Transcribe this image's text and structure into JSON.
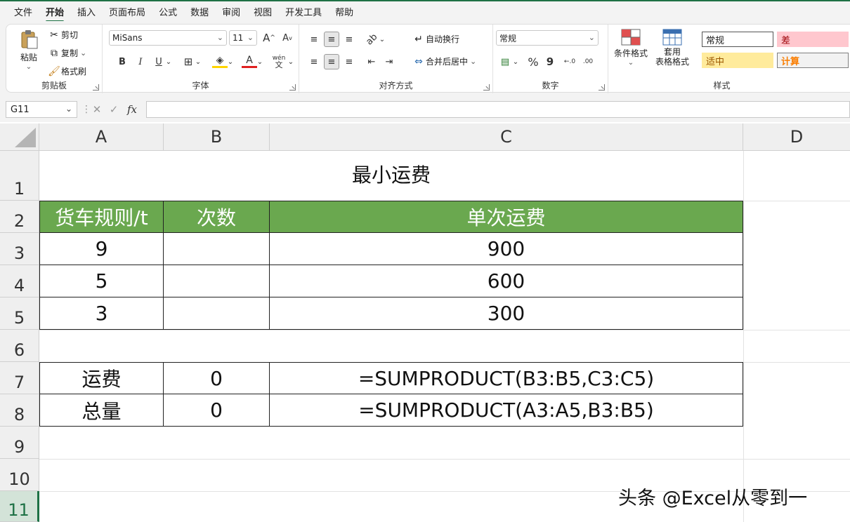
{
  "menu": {
    "items": [
      "文件",
      "开始",
      "插入",
      "页面布局",
      "公式",
      "数据",
      "审阅",
      "视图",
      "开发工具",
      "帮助"
    ],
    "active": "开始"
  },
  "ribbon": {
    "clipboard": {
      "paste": "粘贴",
      "cut": "剪切",
      "copy": "复制",
      "format_painter": "格式刷",
      "label": "剪贴板"
    },
    "font": {
      "name": "MiSans",
      "size": "11",
      "grow": "A",
      "shrink": "A",
      "bold": "B",
      "italic": "I",
      "underline": "U",
      "font_color": "A",
      "wen": "wén",
      "label": "字体"
    },
    "align": {
      "wrap": "自动换行",
      "merge": "合并后居中",
      "label": "对齐方式"
    },
    "number": {
      "format": "常规",
      "percent": "%",
      "comma": "9",
      "label": "数字"
    },
    "styles": {
      "conditional": "条件格式",
      "table_line1": "套用",
      "table_line2": "表格格式",
      "cells": [
        {
          "text": "常规",
          "bg": "#ffffff",
          "fg": "#222222",
          "border": "#555555"
        },
        {
          "text": "差",
          "bg": "#ffc7ce",
          "fg": "#9c0006",
          "border": "#ffc7ce"
        },
        {
          "text": "适中",
          "bg": "#ffeb9c",
          "fg": "#9c5700",
          "border": "#ffeb9c"
        },
        {
          "text": "计算",
          "bg": "#f2f2f2",
          "fg": "#fa7d00",
          "border": "#7f7f7f"
        }
      ],
      "label": "样式"
    }
  },
  "formula_bar": {
    "name_box": "G11",
    "fx": "fx",
    "value": ""
  },
  "columns": [
    {
      "id": "A",
      "label": "A"
    },
    {
      "id": "B",
      "label": "B"
    },
    {
      "id": "C",
      "label": "C"
    },
    {
      "id": "D",
      "label": "D"
    }
  ],
  "rows": [
    "1",
    "2",
    "3",
    "4",
    "5",
    "6",
    "7",
    "8",
    "9",
    "10",
    "11"
  ],
  "selected_row": "11",
  "sheet": {
    "title": "最小运费",
    "header": [
      "货车规则/t",
      "次数",
      "单次运费"
    ],
    "data": [
      [
        "9",
        "",
        "900"
      ],
      [
        "5",
        "",
        "600"
      ],
      [
        "3",
        "",
        "300"
      ]
    ],
    "summary": [
      [
        "运费",
        "0",
        "=SUMPRODUCT(B3:B5,C3:C5)"
      ],
      [
        "总量",
        "0",
        "=SUMPRODUCT(A3:A5,B3:B5)"
      ]
    ]
  },
  "colors": {
    "header_bg": "#6aa84f",
    "accent": "#1e7145"
  },
  "watermark": "头条 @Excel从零到一"
}
